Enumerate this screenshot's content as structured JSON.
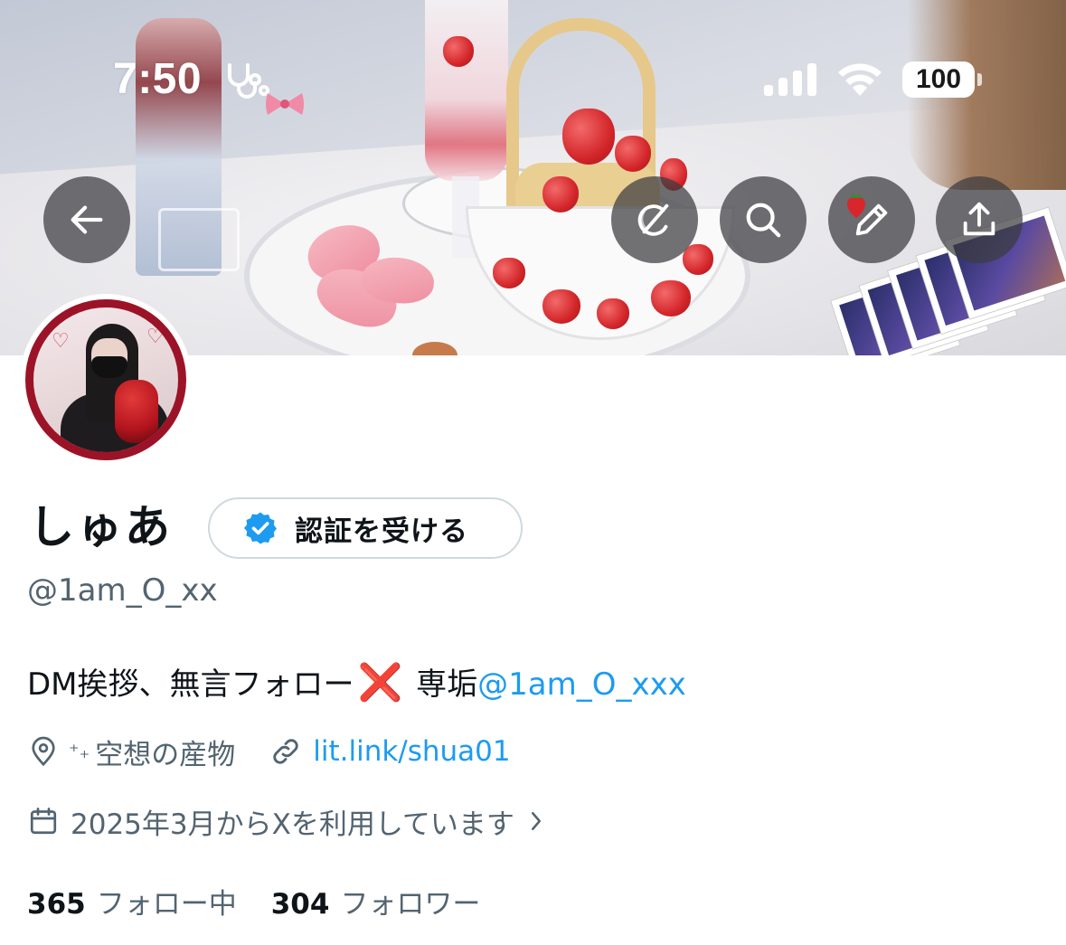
{
  "status_bar": {
    "time": "7:50",
    "battery": "100"
  },
  "header": {
    "back_icon": "arrow-left-icon",
    "grok_icon": "grok-icon",
    "search_icon": "search-icon",
    "edit_icon": "pencil-icon",
    "share_icon": "share-icon"
  },
  "profile": {
    "display_name": "しゅあ",
    "verify_button_label": "認証を受ける",
    "handle": "@1am_O_xx",
    "bio": {
      "text": "DM挨拶、無言フォロー",
      "mark": "❌",
      "suffix": " 専垢",
      "mention": "@1am_O_xxx"
    },
    "location_prefix": "⁺₊",
    "location": "空想の産物",
    "website": "lit.link/shua01",
    "joined": "2025年3月からXを利用しています"
  },
  "stats": {
    "following_count": "365",
    "following_label": "フォロー中",
    "followers_count": "304",
    "followers_label": "フォロワー"
  },
  "colors": {
    "accent": "#1d9bf0",
    "avatar_ring": "#9c1327",
    "secondary_text": "#536471",
    "primary_text": "#0f1419"
  }
}
